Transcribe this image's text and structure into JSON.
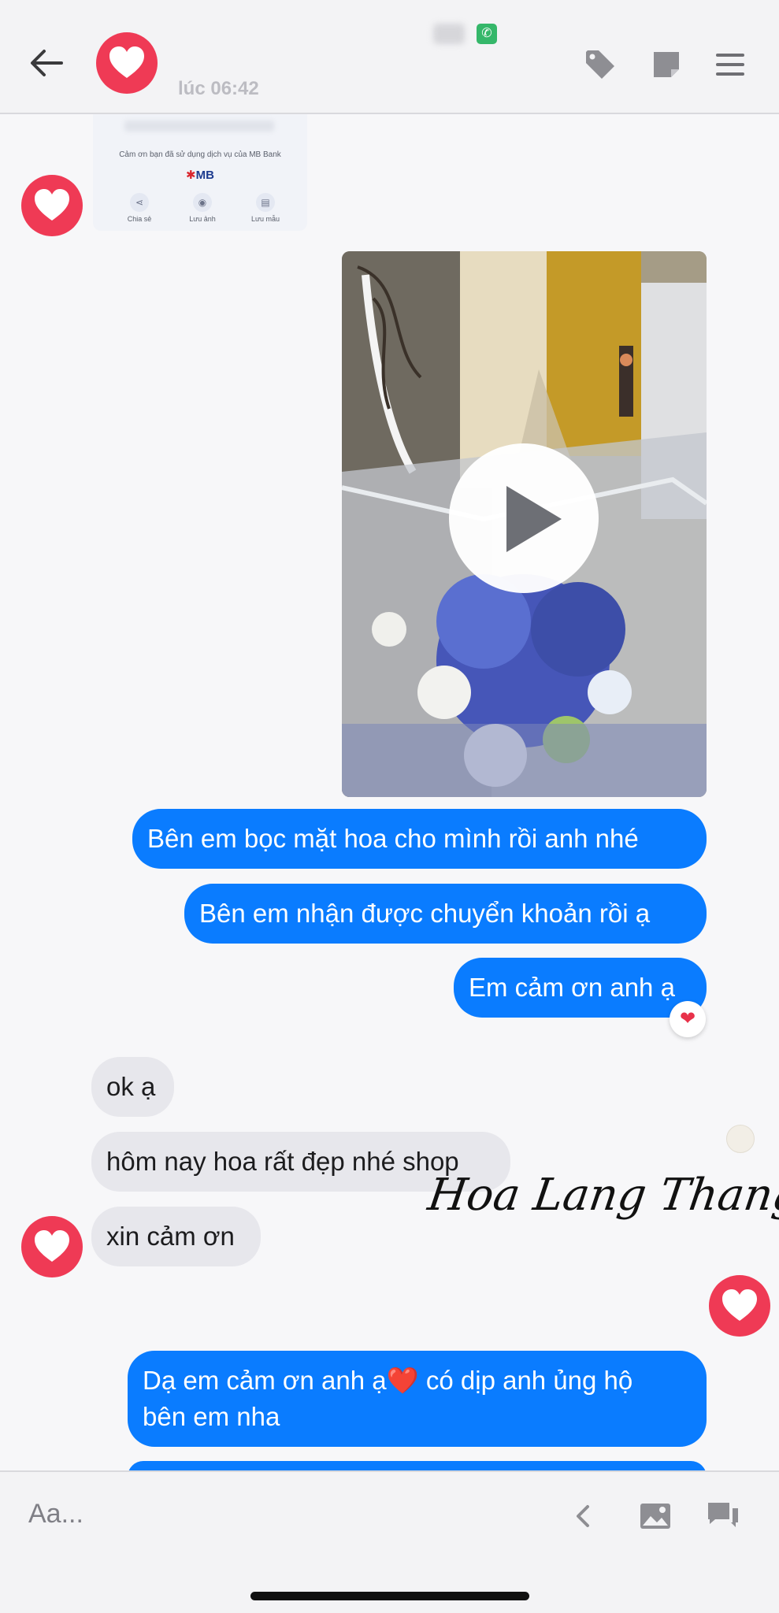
{
  "header": {
    "time_label": "lúc 06:42",
    "call_icon": "phone-icon",
    "icons": [
      "back-arrow-icon",
      "heart-avatar-icon",
      "tag-icon",
      "note-icon",
      "menu-icon"
    ]
  },
  "receipt": {
    "thanks_text": "Cảm ơn bạn đã sử dụng dịch vụ của MB Bank",
    "logo_text": "MB",
    "actions": [
      {
        "label": "Chia sẻ",
        "icon": "share-icon"
      },
      {
        "label": "Lưu ảnh",
        "icon": "camera-icon"
      },
      {
        "label": "Lưu mẫu",
        "icon": "save-template-icon"
      }
    ]
  },
  "video": {
    "icon": "play-icon"
  },
  "messages": {
    "out": [
      "Bên em bọc mặt hoa cho mình rồi anh nhé",
      "Bên em nhận được chuyển khoản rồi ạ",
      "Em cảm ơn anh ạ",
      "Dạ em cảm ơn anh ạ❤️  có dịp anh ủng hộ",
      "bên em nha"
    ],
    "in": [
      "ok ạ",
      "hôm nay hoa rất đẹp nhé shop",
      "xin cảm ơn"
    ],
    "reaction": "❤"
  },
  "watermark": "Hoa Lang Thang",
  "composer": {
    "placeholder": "Aa...",
    "icons": [
      "chevron-left-icon",
      "image-icon",
      "chat-icon"
    ]
  },
  "colors": {
    "outgoing_bubble": "#0a7cff",
    "incoming_bubble": "#e7e7ec",
    "heart_avatar": "#ef3a55"
  }
}
